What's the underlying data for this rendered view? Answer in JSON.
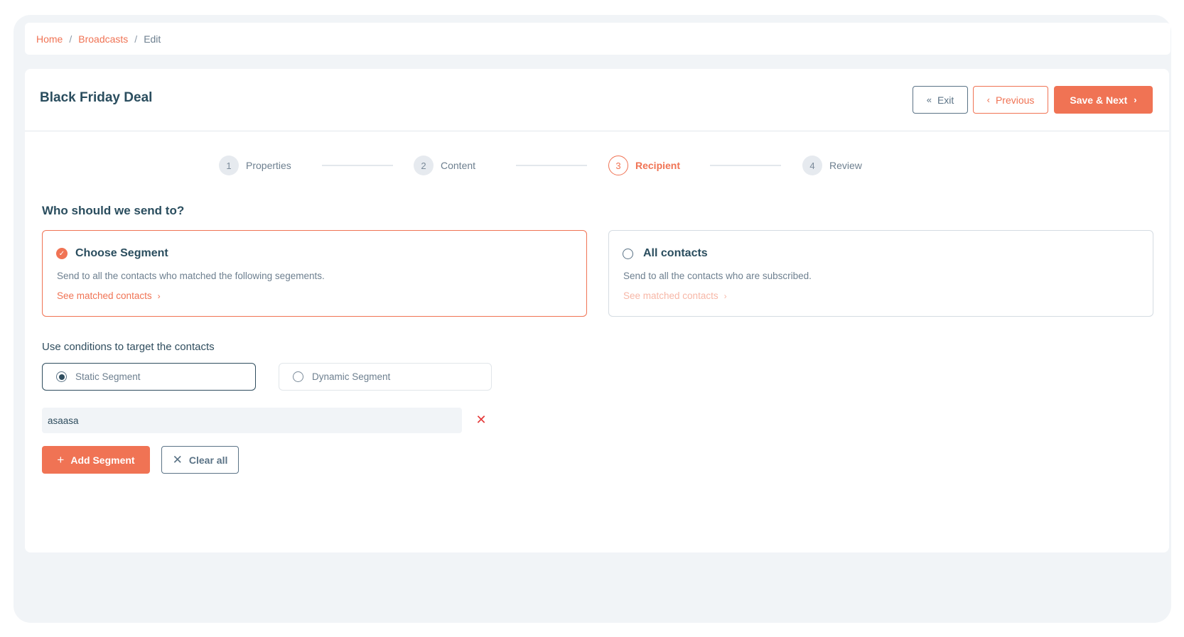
{
  "breadcrumb": [
    {
      "label": "Home",
      "link": true
    },
    {
      "label": "Broadcasts",
      "link": true
    },
    {
      "label": "Edit",
      "link": false
    }
  ],
  "breadcrumb_separator": "/",
  "header": {
    "title": "Black Friday Deal",
    "exit": {
      "label": "Exit",
      "icon": "«"
    },
    "previous": {
      "label": "Previous",
      "icon": "‹"
    },
    "save_next": {
      "label": "Save & Next",
      "icon": "›"
    }
  },
  "stepper": {
    "steps": [
      {
        "num": "1",
        "label": "Properties"
      },
      {
        "num": "2",
        "label": "Content"
      },
      {
        "num": "3",
        "label": "Recipient"
      },
      {
        "num": "4",
        "label": "Review"
      }
    ],
    "active_step": 3
  },
  "recipients": {
    "heading": "Who should we send to?",
    "options": [
      {
        "title": "Choose Segment",
        "desc": "Send to all the contacts who matched the following segements.",
        "link": "See matched contacts",
        "chevron": "›",
        "selected": true
      },
      {
        "title": "All contacts",
        "desc": "Send to all the contacts who are subscribed.",
        "link": "See matched contacts",
        "chevron": "›",
        "selected": false
      }
    ]
  },
  "conditions": {
    "label": "Use conditions to target the contacts",
    "types": [
      {
        "label": "Static Segment",
        "selected": true
      },
      {
        "label": "Dynamic Segment",
        "selected": false
      }
    ],
    "segments": [
      {
        "value": "asaasa",
        "remove_icon": "✕"
      }
    ],
    "add_segment": {
      "label": "Add Segment",
      "icon": "+"
    },
    "clear_all": {
      "label": "Clear all",
      "icon": "✕"
    }
  },
  "colors": {
    "accent": "#f07354",
    "primary_text": "#2a4d5e",
    "muted_text": "#6d7f8f",
    "danger": "#e53b3b",
    "background": "#f1f4f7"
  }
}
